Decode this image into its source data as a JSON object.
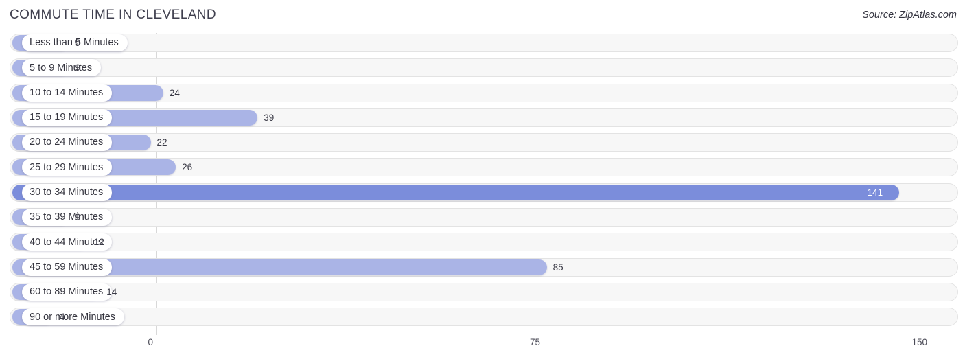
{
  "header": {
    "title": "COMMUTE TIME IN CLEVELAND",
    "source": "Source: ZipAtlas.com"
  },
  "colors": {
    "bar": "#aab4e6",
    "bar_highlight": "#7b8ddb",
    "track": "#f7f7f7",
    "gridline": "#d8d8d8",
    "text": "#3a3a46"
  },
  "chart_data": {
    "type": "bar",
    "orientation": "horizontal",
    "title": "COMMUTE TIME IN CLEVELAND",
    "xlabel": "",
    "ylabel": "",
    "xlim": [
      0,
      150
    ],
    "xticks": [
      0,
      75,
      150
    ],
    "xtick_labels": [
      "0",
      "75",
      "150"
    ],
    "grid": true,
    "legend": false,
    "categories": [
      "Less than 5 Minutes",
      "5 to 9 Minutes",
      "10 to 14 Minutes",
      "15 to 19 Minutes",
      "20 to 24 Minutes",
      "25 to 29 Minutes",
      "30 to 34 Minutes",
      "35 to 39 Minutes",
      "40 to 44 Minutes",
      "45 to 59 Minutes",
      "60 to 89 Minutes",
      "90 or more Minutes"
    ],
    "values": [
      9,
      9,
      24,
      39,
      22,
      26,
      141,
      9,
      12,
      85,
      14,
      4
    ],
    "value_labels": [
      "9",
      "9",
      "24",
      "39",
      "22",
      "26",
      "141",
      "9",
      "12",
      "85",
      "14",
      "4"
    ],
    "highlight_index": 6
  }
}
